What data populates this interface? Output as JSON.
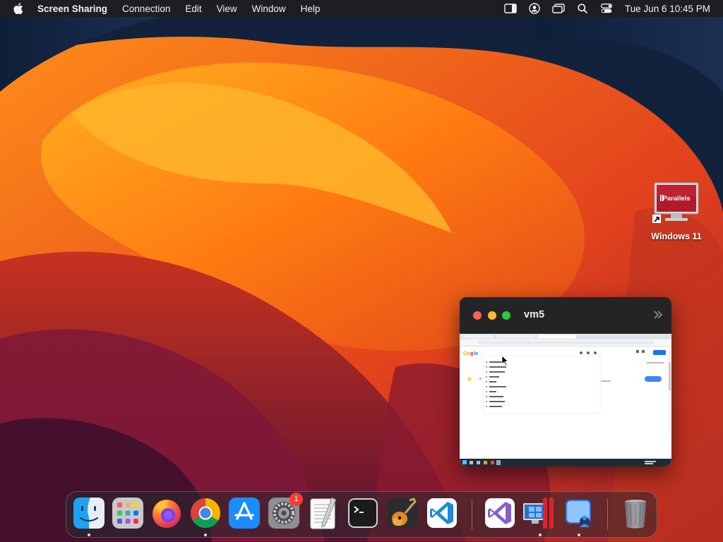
{
  "menubar": {
    "app_name": "Screen Sharing",
    "menus": [
      "Connection",
      "Edit",
      "View",
      "Window",
      "Help"
    ],
    "date_time": "Tue Jun 6  10:45 PM"
  },
  "desktop_icon": {
    "label": "Windows 11",
    "logo_text": "Parallels"
  },
  "preview_window": {
    "title": "vm5"
  },
  "dock": {
    "items": [
      {
        "name": "Finder",
        "running": true
      },
      {
        "name": "Launchpad",
        "running": false
      },
      {
        "name": "Firefox",
        "running": false
      },
      {
        "name": "Google Chrome",
        "running": true
      },
      {
        "name": "App Store",
        "running": false
      },
      {
        "name": "System Settings",
        "running": false,
        "badge": "1"
      },
      {
        "name": "TextEdit",
        "running": false
      },
      {
        "name": "Terminal",
        "running": false
      },
      {
        "name": "GarageBand",
        "running": false
      },
      {
        "name": "Visual Studio Code",
        "running": false
      },
      {
        "name": "Visual Studio",
        "running": false
      },
      {
        "name": "Parallels Desktop",
        "running": true
      },
      {
        "name": "Screen Sharing",
        "running": true
      },
      {
        "name": "Trash",
        "running": false
      }
    ],
    "settings_badge": "1"
  },
  "colors": {
    "menubar_bg": "#1e1e22",
    "close": "#ff5f57",
    "minimize": "#febc2e",
    "zoom": "#28c840",
    "badge": "#ff3b30"
  }
}
